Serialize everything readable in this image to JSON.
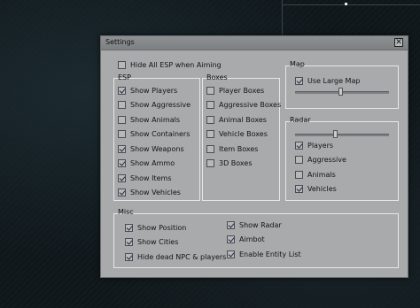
{
  "window": {
    "title": "Settings",
    "close_glyph": "✕"
  },
  "hide_all_esp": {
    "label": "Hide All ESP when Aiming",
    "checked": false
  },
  "esp": {
    "title": "ESP",
    "items": [
      {
        "label": "Show Players",
        "checked": true
      },
      {
        "label": "Show Aggressive",
        "checked": false
      },
      {
        "label": "Show Animals",
        "checked": false
      },
      {
        "label": "Show Containers",
        "checked": false
      },
      {
        "label": "Show Weapons",
        "checked": true
      },
      {
        "label": "Show Ammo",
        "checked": true
      },
      {
        "label": "Show Items",
        "checked": true
      },
      {
        "label": "Show Vehicles",
        "checked": true
      }
    ]
  },
  "boxes": {
    "title": "Boxes",
    "items": [
      {
        "label": "Player Boxes",
        "checked": false
      },
      {
        "label": "Aggressive Boxes",
        "checked": false
      },
      {
        "label": "Animal Boxes",
        "checked": false
      },
      {
        "label": "Vehicle Boxes",
        "checked": false
      },
      {
        "label": "Item Boxes",
        "checked": false
      },
      {
        "label": "3D Boxes",
        "checked": false
      }
    ]
  },
  "map": {
    "title": "Map",
    "use_large_map": {
      "label": "Use Large Map",
      "checked": true
    },
    "slider_value": 0.48
  },
  "radar": {
    "title": "Radar",
    "slider_value": 0.42,
    "items": [
      {
        "label": "Players",
        "checked": true
      },
      {
        "label": "Aggressive",
        "checked": false
      },
      {
        "label": "Animals",
        "checked": false
      },
      {
        "label": "Vehicles",
        "checked": true
      }
    ]
  },
  "misc": {
    "title": "Misc",
    "left": [
      {
        "label": "Show Position",
        "checked": true
      },
      {
        "label": "Show Cities",
        "checked": true
      },
      {
        "label": "Hide dead NPC & players",
        "checked": true
      }
    ],
    "right": [
      {
        "label": "Show Radar",
        "checked": true
      },
      {
        "label": "Aimbot",
        "checked": true
      },
      {
        "label": "Enable Entity List",
        "checked": true
      }
    ]
  }
}
